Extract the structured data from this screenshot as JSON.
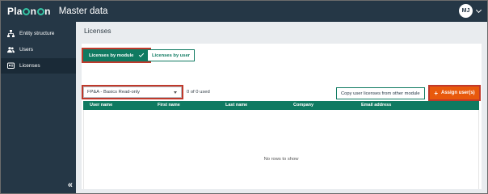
{
  "app": {
    "logo_text_a": "Pla",
    "logo_text_b": "n",
    "logo_text_c": "n",
    "title": "Master data",
    "user_initials": "MJ"
  },
  "sidebar": {
    "items": [
      {
        "label": "Entity structure",
        "icon": "sitemap-icon",
        "active": false
      },
      {
        "label": "Users",
        "icon": "users-icon",
        "active": false
      },
      {
        "label": "Licenses",
        "icon": "license-icon",
        "active": true
      }
    ],
    "collapse_label": "«"
  },
  "page": {
    "title": "Licenses",
    "tabs": [
      {
        "label": "Licenses by module",
        "active": true
      },
      {
        "label": "Licenses by user",
        "active": false
      }
    ],
    "module_select": {
      "value": "FP&A - Basics Read-only"
    },
    "usage_text": "0 of 0 used",
    "copy_button": "Copy user licenses from other module",
    "assign_button": "Assign user(s)",
    "grid": {
      "columns": [
        "User name",
        "First name",
        "Last name",
        "Company",
        "Email address"
      ],
      "rows": [],
      "empty_text": "No rows to show"
    }
  },
  "colors": {
    "topbar": "#253746",
    "accent_green": "#0f7a61",
    "assign_orange": "#e8590c",
    "highlight_red": "#c0392b",
    "logo_teal": "#35c4a4"
  }
}
